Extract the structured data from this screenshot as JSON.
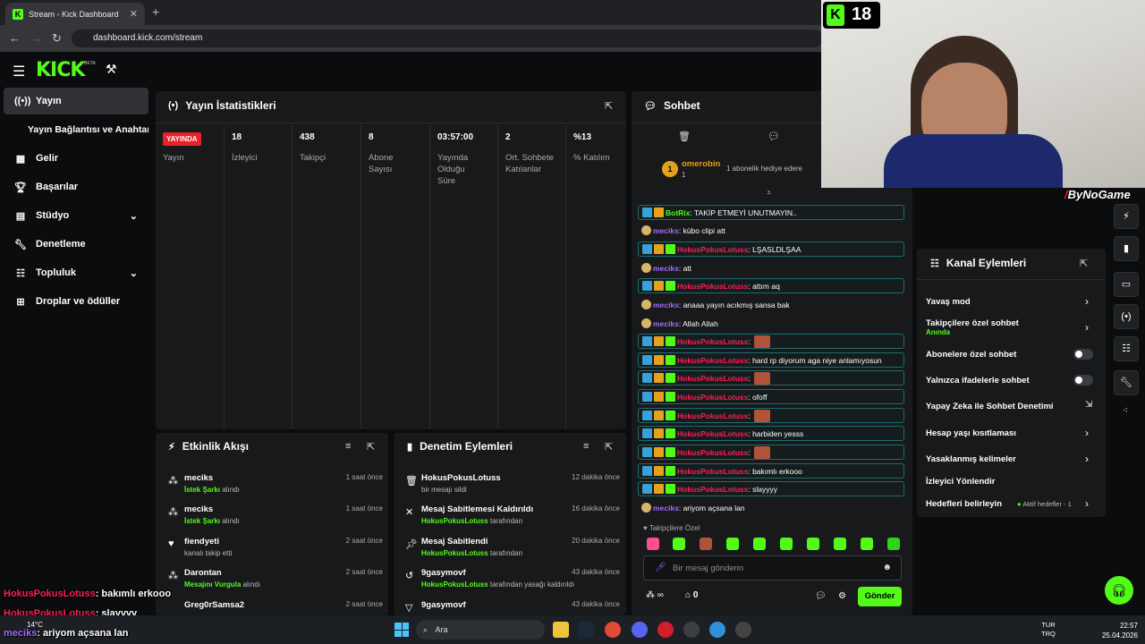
{
  "browser": {
    "tab_title": "Stream - Kick Dashboard",
    "url": "dashboard.kick.com/stream"
  },
  "header": {
    "logo": "KICK",
    "beta": "BETA"
  },
  "sidebar": {
    "items": [
      {
        "label": "Yayın",
        "icon": "broadcast-icon"
      },
      {
        "label": "Yayın Bağlantısı ve Anahtarı",
        "icon": ""
      },
      {
        "label": "Gelir",
        "icon": "revenue-icon"
      },
      {
        "label": "Başarılar",
        "icon": "trophy-icon"
      },
      {
        "label": "Stüdyo",
        "icon": "studio-icon"
      },
      {
        "label": "Denetleme",
        "icon": "wrench-icon"
      },
      {
        "label": "Topluluk",
        "icon": "community-icon"
      },
      {
        "label": "Droplar ve ödüller",
        "icon": "drops-icon"
      }
    ]
  },
  "stats": {
    "title": "Yayın İstatistikleri",
    "live_badge": "YAYINDA",
    "live_label": "Yayın",
    "columns": [
      {
        "value": "18",
        "label": "İzleyici"
      },
      {
        "value": "438",
        "label": "Takipçi"
      },
      {
        "value": "8",
        "label": "Abone Sayısı"
      },
      {
        "value": "03:57:00",
        "label": "Yayında Olduğu Süre"
      },
      {
        "value": "2",
        "label": "Ort. Sohbete Katılanlar"
      },
      {
        "value": "%13",
        "label": "% Katılım"
      }
    ]
  },
  "activity": {
    "title": "Etkinlik Akışı",
    "rows": [
      {
        "name": "meciks",
        "detail_green": "İstek Şarkı",
        "detail": " alındı",
        "time": "1 saat önce"
      },
      {
        "name": "meciks",
        "detail_green": "İstek Şarkı",
        "detail": " alındı",
        "time": "1 saat önce"
      },
      {
        "name": "fiendyeti",
        "detail_green": "",
        "detail": "kanalı takip etti",
        "time": "2 saat önce"
      },
      {
        "name": "Darontan",
        "detail_green": "Mesajını Vurgula",
        "detail": " alındı",
        "time": "2 saat önce"
      },
      {
        "name": "Greg0rSamsa2",
        "detail_green": "",
        "detail": "",
        "time": "2 saat önce"
      }
    ]
  },
  "moderation": {
    "title": "Denetim Eylemleri",
    "rows": [
      {
        "name": "HokusPokusLotuss",
        "detail_green": "",
        "detail": "bir mesajı sildi",
        "time": "12 dakika önce"
      },
      {
        "name": "Mesaj Sabitlemesi Kaldırıldı",
        "detail_green": "HokusPokusLotuss",
        "detail": " tarafından",
        "time": "16 dakika önce"
      },
      {
        "name": "Mesaj Sabitlendi",
        "detail_green": "HokusPokusLotuss",
        "detail": " tarafından",
        "time": "20 dakika önce"
      },
      {
        "name": "9gasymovf",
        "detail_green": "HokusPokusLotuss",
        "detail": " tarafından yasağı kaldırıldı",
        "time": "43 dakika önce"
      },
      {
        "name": "9gasymovf",
        "detail_green": "",
        "detail": "",
        "time": "43 dakika önce"
      }
    ]
  },
  "chat": {
    "title": "Sohbet",
    "pinned_user": "omerobin",
    "pinned_count": "1",
    "gift_text": "1 abonelik hediye edere",
    "messages": [
      {
        "user": "BotRix",
        "text": ": TAKİP ETMEYİ UNUTMAYIN..",
        "color": "#53fc18",
        "boxed": true,
        "badges": 2
      },
      {
        "user": "meciks",
        "text": ": kübo clipi att",
        "color": "#a46bff",
        "boxed": false,
        "badges": 0
      },
      {
        "user": "HokusPokusLotuss",
        "text": ": LŞASLDLŞAA",
        "color": "#ff1e56",
        "boxed": true,
        "badges": 3
      },
      {
        "user": "meciks",
        "text": ": att",
        "color": "#a46bff",
        "boxed": false,
        "badges": 0
      },
      {
        "user": "HokusPokusLotuss",
        "text": ": attım aq",
        "color": "#ff1e56",
        "boxed": true,
        "badges": 3
      },
      {
        "user": "meciks",
        "text": ": anaaa yayın acıkmış sansa bak",
        "color": "#a46bff",
        "boxed": false,
        "badges": 0
      },
      {
        "user": "meciks",
        "text": ": Allah Allah",
        "color": "#a46bff",
        "boxed": false,
        "badges": 0
      },
      {
        "user": "HokusPokusLotuss",
        "text": ":",
        "color": "#ff1e56",
        "boxed": true,
        "badges": 3,
        "emote": true
      },
      {
        "user": "HokusPokusLotuss",
        "text": ": hard rp diyorum aga niye anlamıyosun",
        "color": "#ff1e56",
        "boxed": true,
        "badges": 3
      },
      {
        "user": "HokusPokusLotuss",
        "text": ":",
        "color": "#ff1e56",
        "boxed": true,
        "badges": 3,
        "emote": true
      },
      {
        "user": "HokusPokusLotuss",
        "text": ": ofoff",
        "color": "#ff1e56",
        "boxed": true,
        "badges": 3
      },
      {
        "user": "HokusPokusLotuss",
        "text": ":",
        "color": "#ff1e56",
        "boxed": true,
        "badges": 3,
        "emote": true
      },
      {
        "user": "HokusPokusLotuss",
        "text": ": harbiden yesss",
        "color": "#ff1e56",
        "boxed": true,
        "badges": 3
      },
      {
        "user": "HokusPokusLotuss",
        "text": ":",
        "color": "#ff1e56",
        "boxed": true,
        "badges": 3,
        "emote": true
      },
      {
        "user": "HokusPokusLotuss",
        "text": ": bakımlı erkooo",
        "color": "#ff1e56",
        "boxed": true,
        "badges": 3
      },
      {
        "user": "HokusPokusLotuss",
        "text": ": slayyyy",
        "color": "#ff1e56",
        "boxed": true,
        "badges": 3
      },
      {
        "user": "meciks",
        "text": ": ariyom açsana lan",
        "color": "#a46bff",
        "boxed": false,
        "badges": 0
      }
    ],
    "followers_only": "Takipçilere Özel",
    "input_placeholder": "Bir mesaj gönderin",
    "viewer_count": "∞",
    "gift_count": "0",
    "send_label": "Gönder"
  },
  "channel_actions": {
    "title": "Kanal Eylemleri",
    "items": [
      {
        "label": "Yavaş mod",
        "sub": "",
        "control": "chevron"
      },
      {
        "label": "Takipçilere özel sohbet",
        "sub": "Anında",
        "control": "chevron"
      },
      {
        "label": "Abonelere özel sohbet",
        "sub": "",
        "control": "toggle"
      },
      {
        "label": "Yalnızca ifadelerle sohbet",
        "sub": "",
        "control": "toggle"
      },
      {
        "label": "Yapay Zeka ile Sohbet Denetimi",
        "sub": "",
        "control": "external"
      },
      {
        "label": "Hesap yaşı kısıtlaması",
        "sub": "",
        "control": "chevron"
      },
      {
        "label": "Yasaklanmış kelimeler",
        "sub": "",
        "control": "chevron"
      },
      {
        "label": "İzleyici Yönlendir",
        "sub": "",
        "control": "none"
      },
      {
        "label": "Hedefleri belirleyin",
        "sub": "",
        "control": "chevron",
        "extra": "Aktif hedefler - 1"
      }
    ]
  },
  "overlay": {
    "age_badge": "18",
    "brand": "ByNoGame",
    "lines": [
      {
        "user": "HokusPokusLotuss",
        "text": ": bakımlı erkooo"
      },
      {
        "user": "HokusPokusLotuss",
        "text": ": slayyyy"
      },
      {
        "user": "meciks",
        "text": ": ariyom açsana lan"
      }
    ]
  },
  "taskbar": {
    "weather": "14°C",
    "search": "Ara",
    "lang1": "TUR",
    "lang2": "TRQ",
    "time": "22:57",
    "date": "25.04.2026"
  }
}
